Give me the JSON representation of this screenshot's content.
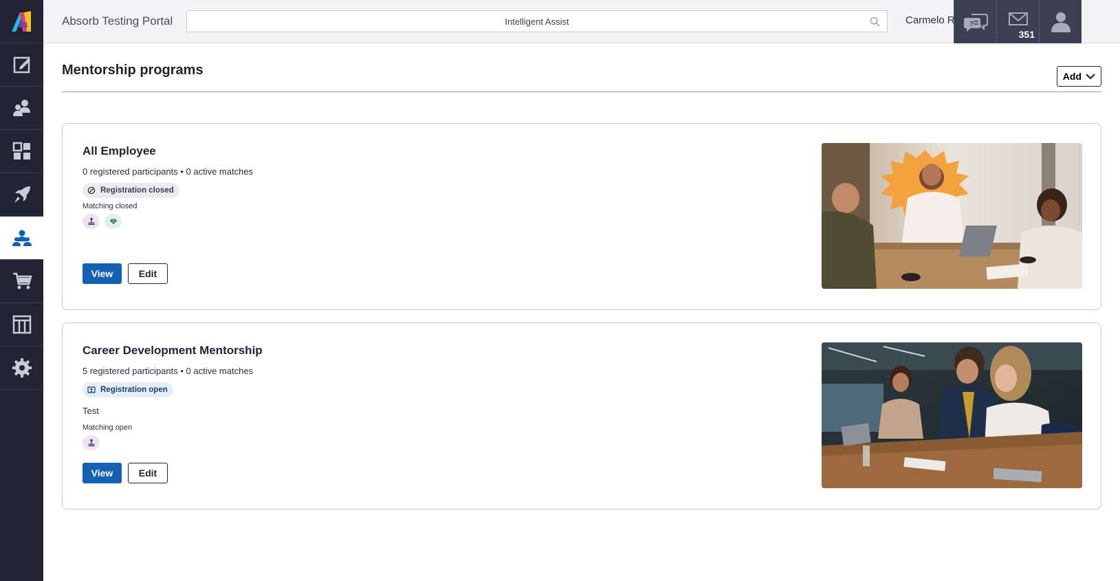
{
  "header": {
    "portal_title": "Absorb Testing Portal",
    "search_placeholder": "Intelligent Assist",
    "user_name": "Carmelo Rubio",
    "message_count": "351"
  },
  "sidebar": {
    "items": [
      {
        "icon": "edit-note-icon",
        "active": false
      },
      {
        "icon": "users-icon",
        "active": false
      },
      {
        "icon": "dashboard-icon",
        "active": false
      },
      {
        "icon": "rocket-icon",
        "active": false
      },
      {
        "icon": "mentorship-icon",
        "active": true
      },
      {
        "icon": "cart-icon",
        "active": false
      },
      {
        "icon": "columns-icon",
        "active": false
      },
      {
        "icon": "gear-icon",
        "active": false
      }
    ]
  },
  "page": {
    "title": "Mentorship programs",
    "add_label": "Add"
  },
  "programs": [
    {
      "name": "All Employee",
      "stats": "0 registered participants • 0 active matches",
      "registration_status": "Registration closed",
      "description": "",
      "matching_status": "Matching closed",
      "view_label": "View",
      "edit_label": "Edit"
    },
    {
      "name": "Career Development Mentorship",
      "stats": "5 registered participants • 0 active matches",
      "registration_status": "Registration open",
      "description": "Test",
      "matching_status": "Matching open",
      "view_label": "View",
      "edit_label": "Edit"
    }
  ],
  "colors": {
    "sidebar_bg": "#222433",
    "primary_blue": "#1460b5",
    "header_btn_bg": "#3b3f52"
  }
}
